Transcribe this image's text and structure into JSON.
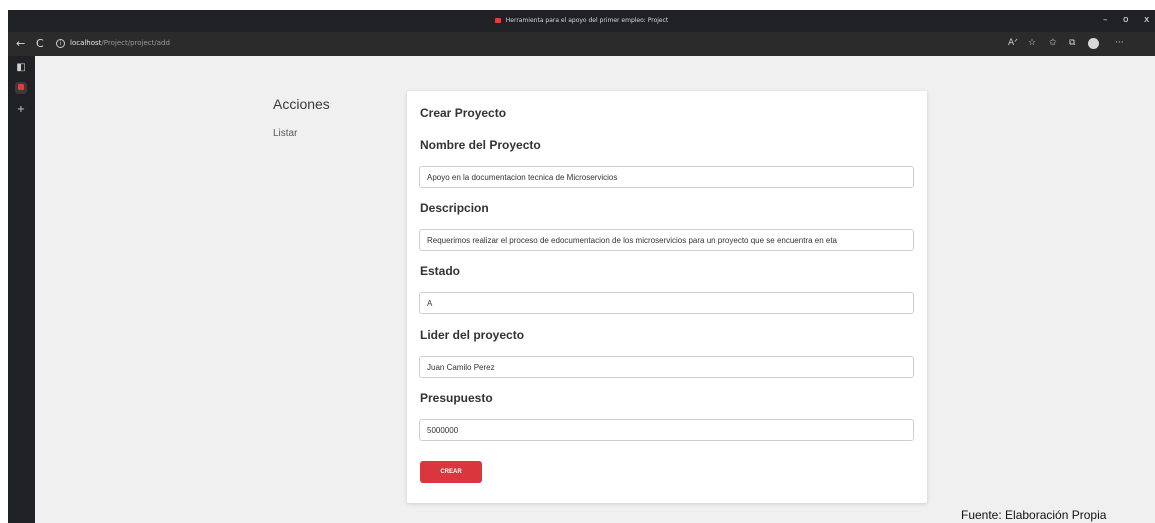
{
  "window": {
    "title": "Herramienta para el apoyo del primer empleo: Project",
    "minimize": "–",
    "restore": "o",
    "close": "x"
  },
  "addressbar": {
    "back": "←",
    "reload": "C",
    "info": "i",
    "url_host": "localhost",
    "url_path": "/Project/project/add"
  },
  "toolbar_icons": [
    "read-aloud-icon",
    "favorite-add-icon",
    "favorites-icon",
    "collections-icon",
    "profile-icon",
    "more-icon"
  ],
  "sidebar": {
    "heading": "Acciones",
    "items": [
      {
        "label": "Listar"
      }
    ]
  },
  "form": {
    "title": "Crear Proyecto",
    "fields": [
      {
        "label": "Nombre del Proyecto",
        "value": "Apoyo en la documentacion tecnica de Microservicios"
      },
      {
        "label": "Descripcion",
        "value": "Requerimos realizar el proceso de edocumentacion de los microservicios para un proyecto que se encuentra en eta"
      },
      {
        "label": "Estado",
        "value": "A"
      },
      {
        "label": "Lider del proyecto",
        "value": "Juan Camilo Perez"
      },
      {
        "label": "Presupuesto",
        "value": "5000000"
      }
    ],
    "submit_label": "CREAR"
  },
  "caption": "Fuente: Elaboración Propia",
  "colors": {
    "accent": "#d9363e",
    "page_bg": "#f0f0f0",
    "chrome": "#202124"
  }
}
